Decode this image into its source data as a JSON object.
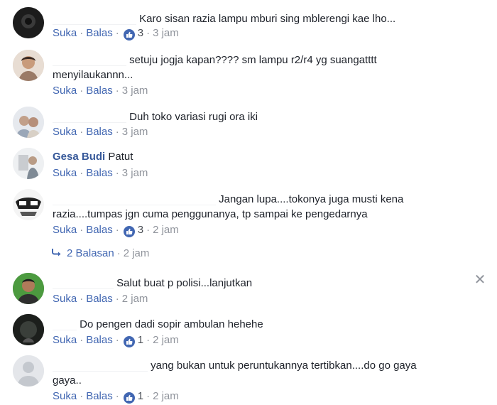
{
  "action_like": "Suka",
  "action_reply": "Balas",
  "separator": "·",
  "comments": [
    {
      "name": "",
      "text": "Karo sisan razia lampu mburi sing mblerengi kae lho...",
      "like_count": "3",
      "time": "3 jam"
    },
    {
      "name": "",
      "text_line1": "setuju jogja kapan???? sm lampu r2/r4 yg suangatttt",
      "text_line2": "menyilaukannn...",
      "time": "3 jam"
    },
    {
      "name": "",
      "text": "Duh toko variasi rugi ora iki",
      "time": "3 jam"
    },
    {
      "name": "Gesa Budi",
      "text": "Patut",
      "time": "3 jam"
    },
    {
      "name": "",
      "text_line1": "Jangan lupa....tokonya juga musti kena",
      "text_line2": "razia....tumpas jgn cuma penggunanya, tp sampai ke pengedarnya",
      "like_count": "3",
      "time": "2 jam"
    },
    {
      "name": "",
      "text": "Salut buat p polisi...lanjutkan",
      "time": "2 jam"
    },
    {
      "name": "",
      "text": "Do pengen dadi sopir ambulan hehehe",
      "like_count": "1",
      "time": "2 jam"
    },
    {
      "name": "",
      "text_line1": "yang bukan untuk peruntukannya tertibkan....do go gaya",
      "text_line2": "gaya..",
      "like_count": "1",
      "time": "2 jam"
    }
  ],
  "replies": {
    "label": "2 Balasan",
    "time": "2 jam"
  },
  "icons": {
    "like": "thumbs-up-icon",
    "reply": "reply-arrow-icon",
    "close": "close-icon"
  },
  "colors": {
    "link": "#4267b2",
    "name": "#365899",
    "meta": "#90949c",
    "like_badge": "#4267b2"
  }
}
